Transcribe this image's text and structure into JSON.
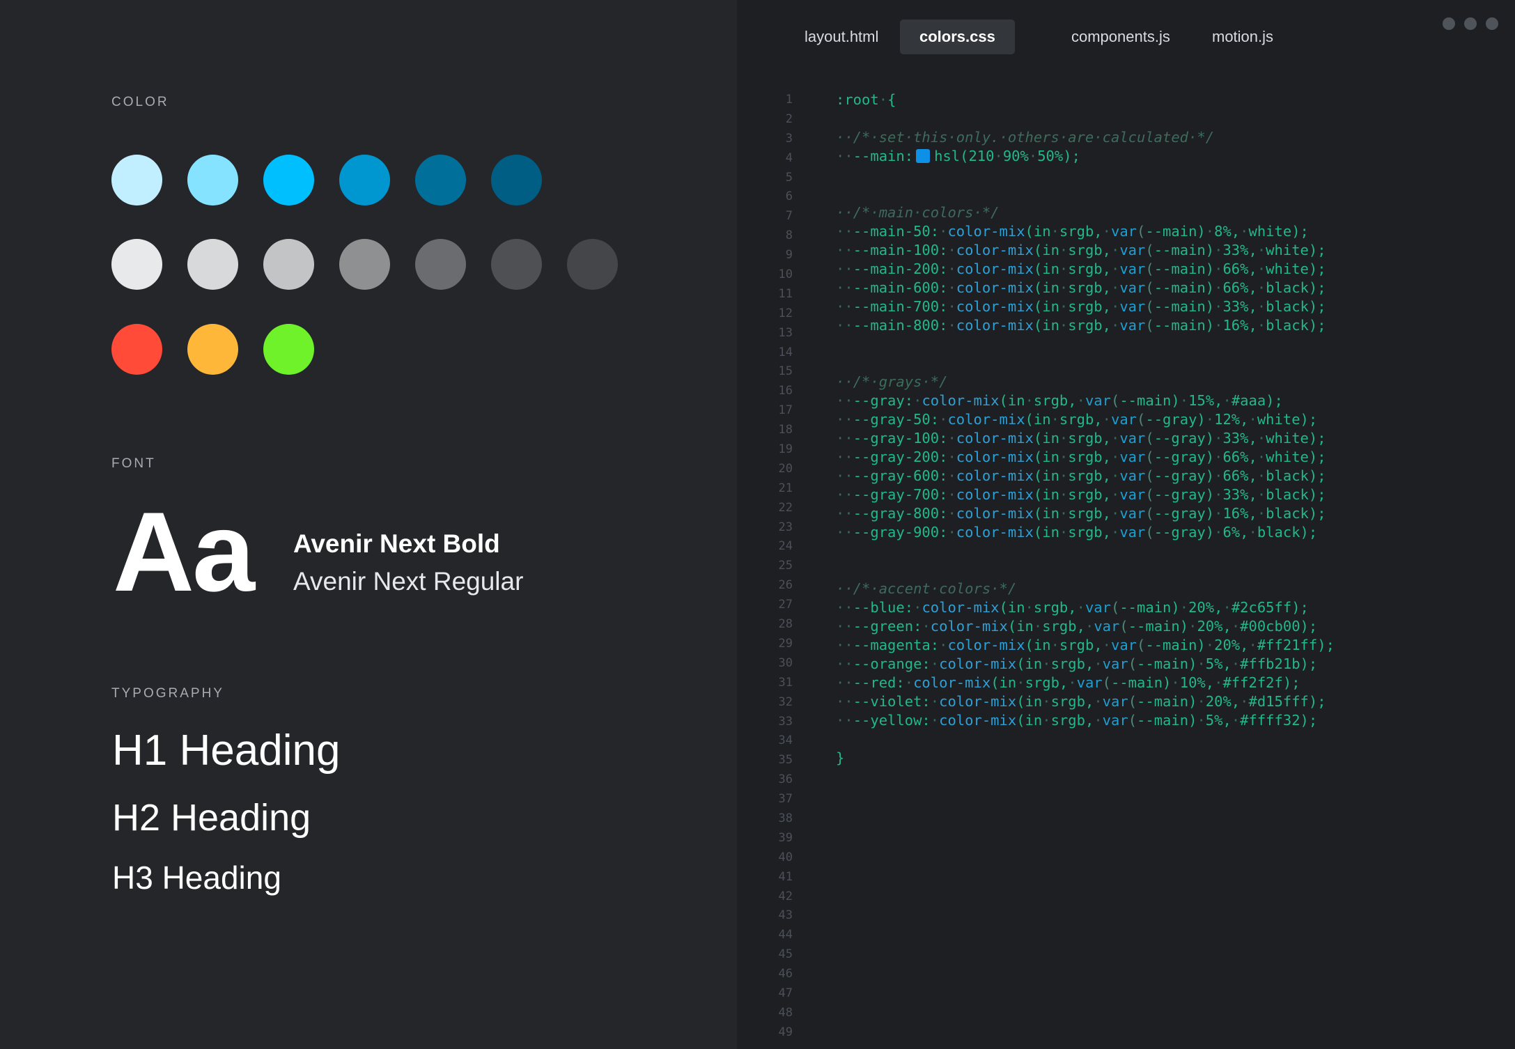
{
  "left": {
    "color_label": "COLOR",
    "swatches": {
      "row1": [
        "#c2efff",
        "#85e3ff",
        "#00bfff",
        "#0096cf",
        "#00709b",
        "#005e84"
      ],
      "row2": [
        "#e8e9ea",
        "#d7d9db",
        "#c2c4c6",
        "#8e9092",
        "#6a6c70",
        "#4e5054",
        "#44464a"
      ],
      "row3": [
        "#ff4b38",
        "#ffb73a",
        "#6ff22a"
      ]
    },
    "font_label": "FONT",
    "font_sample": "Aa",
    "font_bold": "Avenir Next Bold",
    "font_regular": "Avenir Next Regular",
    "typography_label": "TYPOGRAPHY",
    "h1": "H1 Heading",
    "h2": "H2 Heading",
    "h3": "H3 Heading"
  },
  "editor": {
    "tabs": [
      {
        "label": "layout.html",
        "active": false
      },
      {
        "label": "colors.css",
        "active": true
      },
      {
        "label": "components.js",
        "active": false
      },
      {
        "label": "motion.js",
        "active": false
      }
    ],
    "line_count": 49,
    "swatch_color": "#0e90e6",
    "code_lines": [
      ":root·{",
      "",
      "··/*·set·this·only.·others·are·calculated·*/",
      "··--main:",
      "",
      "",
      "··/*·main·colors·*/",
      "··--main-50:·color-mix(in·srgb,·var(--main)·8%,·white);",
      "··--main-100:·color-mix(in·srgb,·var(--main)·33%,·white);",
      "··--main-200:·color-mix(in·srgb,·var(--main)·66%,·white);",
      "··--main-600:·color-mix(in·srgb,·var(--main)·66%,·black);",
      "··--main-700:·color-mix(in·srgb,·var(--main)·33%,·black);",
      "··--main-800:·color-mix(in·srgb,·var(--main)·16%,·black);",
      "",
      "",
      "··/*·grays·*/",
      "··--gray:·color-mix(in·srgb,·var(--main)·15%,·#aaa);",
      "··--gray-50:·color-mix(in·srgb,·var(--gray)·12%,·white);",
      "··--gray-100:·color-mix(in·srgb,·var(--gray)·33%,·white);",
      "··--gray-200:·color-mix(in·srgb,·var(--gray)·66%,·white);",
      "··--gray-600:·color-mix(in·srgb,·var(--gray)·66%,·black);",
      "··--gray-700:·color-mix(in·srgb,·var(--gray)·33%,·black);",
      "··--gray-800:·color-mix(in·srgb,·var(--gray)·16%,·black);",
      "··--gray-900:·color-mix(in·srgb,·var(--gray)·6%,·black);",
      "",
      "",
      "··/*·accent·colors·*/",
      "··--blue:·color-mix(in·srgb,·var(--main)·20%,·#2c65ff);",
      "··--green:·color-mix(in·srgb,·var(--main)·20%,·#00cb00);",
      "··--magenta:·color-mix(in·srgb,·var(--main)·20%,·#ff21ff);",
      "··--orange:·color-mix(in·srgb,·var(--main)·5%,·#ffb21b);",
      "··--red:·color-mix(in·srgb,·var(--main)·10%,·#ff2f2f);",
      "··--violet:·color-mix(in·srgb,·var(--main)·20%,·#d15fff);",
      "··--yellow:·color-mix(in·srgb,·var(--main)·5%,·#ffff32);",
      "",
      "}"
    ],
    "main_value": "hsl(210·90%·50%);"
  }
}
